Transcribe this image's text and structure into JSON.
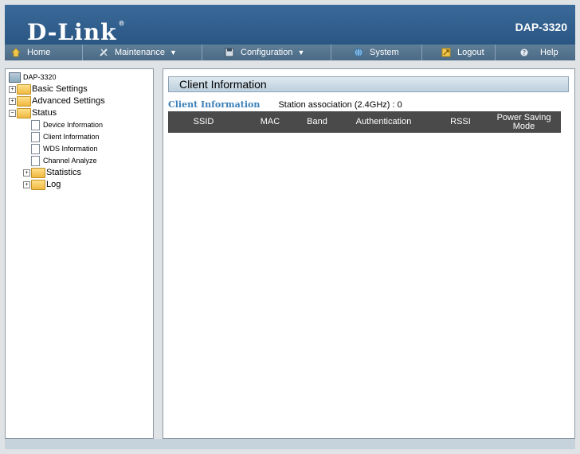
{
  "header": {
    "brand": "D-Link",
    "model": "DAP-3320"
  },
  "nav": {
    "home": "Home",
    "maintenance": "Maintenance",
    "configuration": "Configuration",
    "system": "System",
    "logout": "Logout",
    "help": "Help"
  },
  "tree": {
    "root": "DAP-3320",
    "basic": "Basic Settings",
    "advanced": "Advanced Settings",
    "status": "Status",
    "device_info": "Device Information",
    "client_info": "Client Information",
    "wds_info": "WDS Information",
    "channel": "Channel Analyze",
    "statistics": "Statistics",
    "log": "Log"
  },
  "content": {
    "title": "Client Information",
    "section_title": "Client Information",
    "association_label": "Station association (2.4GHz) :",
    "association_count": "0",
    "columns": [
      "SSID",
      "MAC",
      "Band",
      "Authentication",
      "RSSI",
      "Power Saving Mode"
    ]
  },
  "colors": {
    "accent": "#2a5683",
    "header_table": "#4a4a4a",
    "section_title": "#3a7fb8"
  }
}
